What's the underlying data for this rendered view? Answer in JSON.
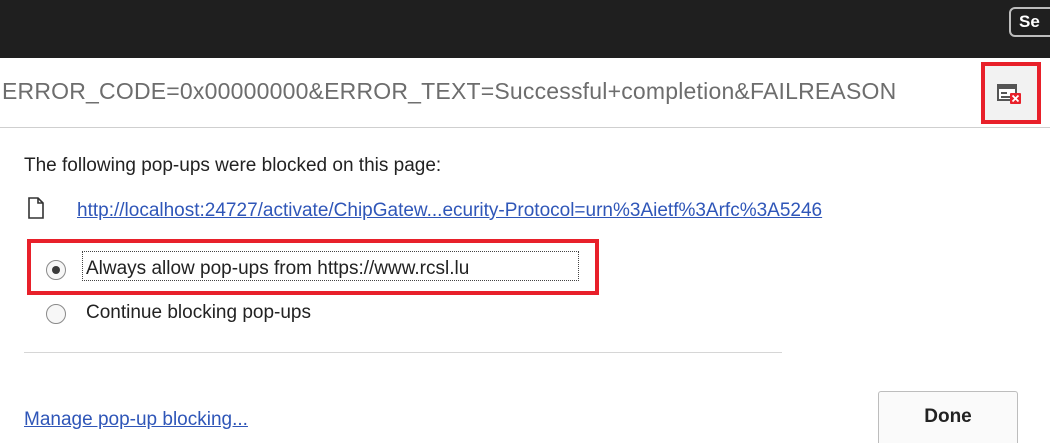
{
  "topbar": {
    "button_label": "Se"
  },
  "address_bar": {
    "url": "ERROR_CODE=0x00000000&ERROR_TEXT=Successful+completion&FAILREASON",
    "popup_blocked_icon": "popup-blocked-icon"
  },
  "popup_bubble": {
    "heading": "The following pop-ups were blocked on this page:",
    "blocked_item": {
      "icon": "document-icon",
      "link": "http://localhost:24727/activate/ChipGatew...ecurity-Protocol=urn%3Aietf%3Arfc%3A5246"
    },
    "options": [
      {
        "label": "Always allow pop-ups from https://www.rcsl.lu",
        "checked": true
      },
      {
        "label": "Continue blocking pop-ups",
        "checked": false
      }
    ],
    "manage_link": "Manage pop-up blocking...",
    "done_label": "Done"
  },
  "colors": {
    "highlight": "#e8202a",
    "link": "#2f56b8",
    "topbar": "#1f1f1f"
  }
}
